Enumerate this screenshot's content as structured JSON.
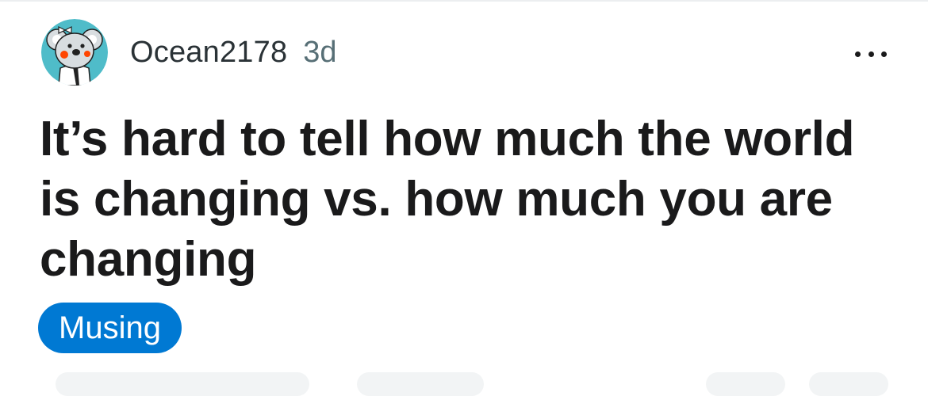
{
  "post": {
    "author": "Ocean2178",
    "age": "3d",
    "title": "It’s hard to tell how much the world is changing vs. how much you are changing",
    "flair": "Musing"
  },
  "colors": {
    "flair_bg": "#0079d3",
    "avatar_bg": "#4fbcc9"
  },
  "icons": {
    "avatar": "koala-avatar-icon",
    "more": "more-options-icon"
  }
}
